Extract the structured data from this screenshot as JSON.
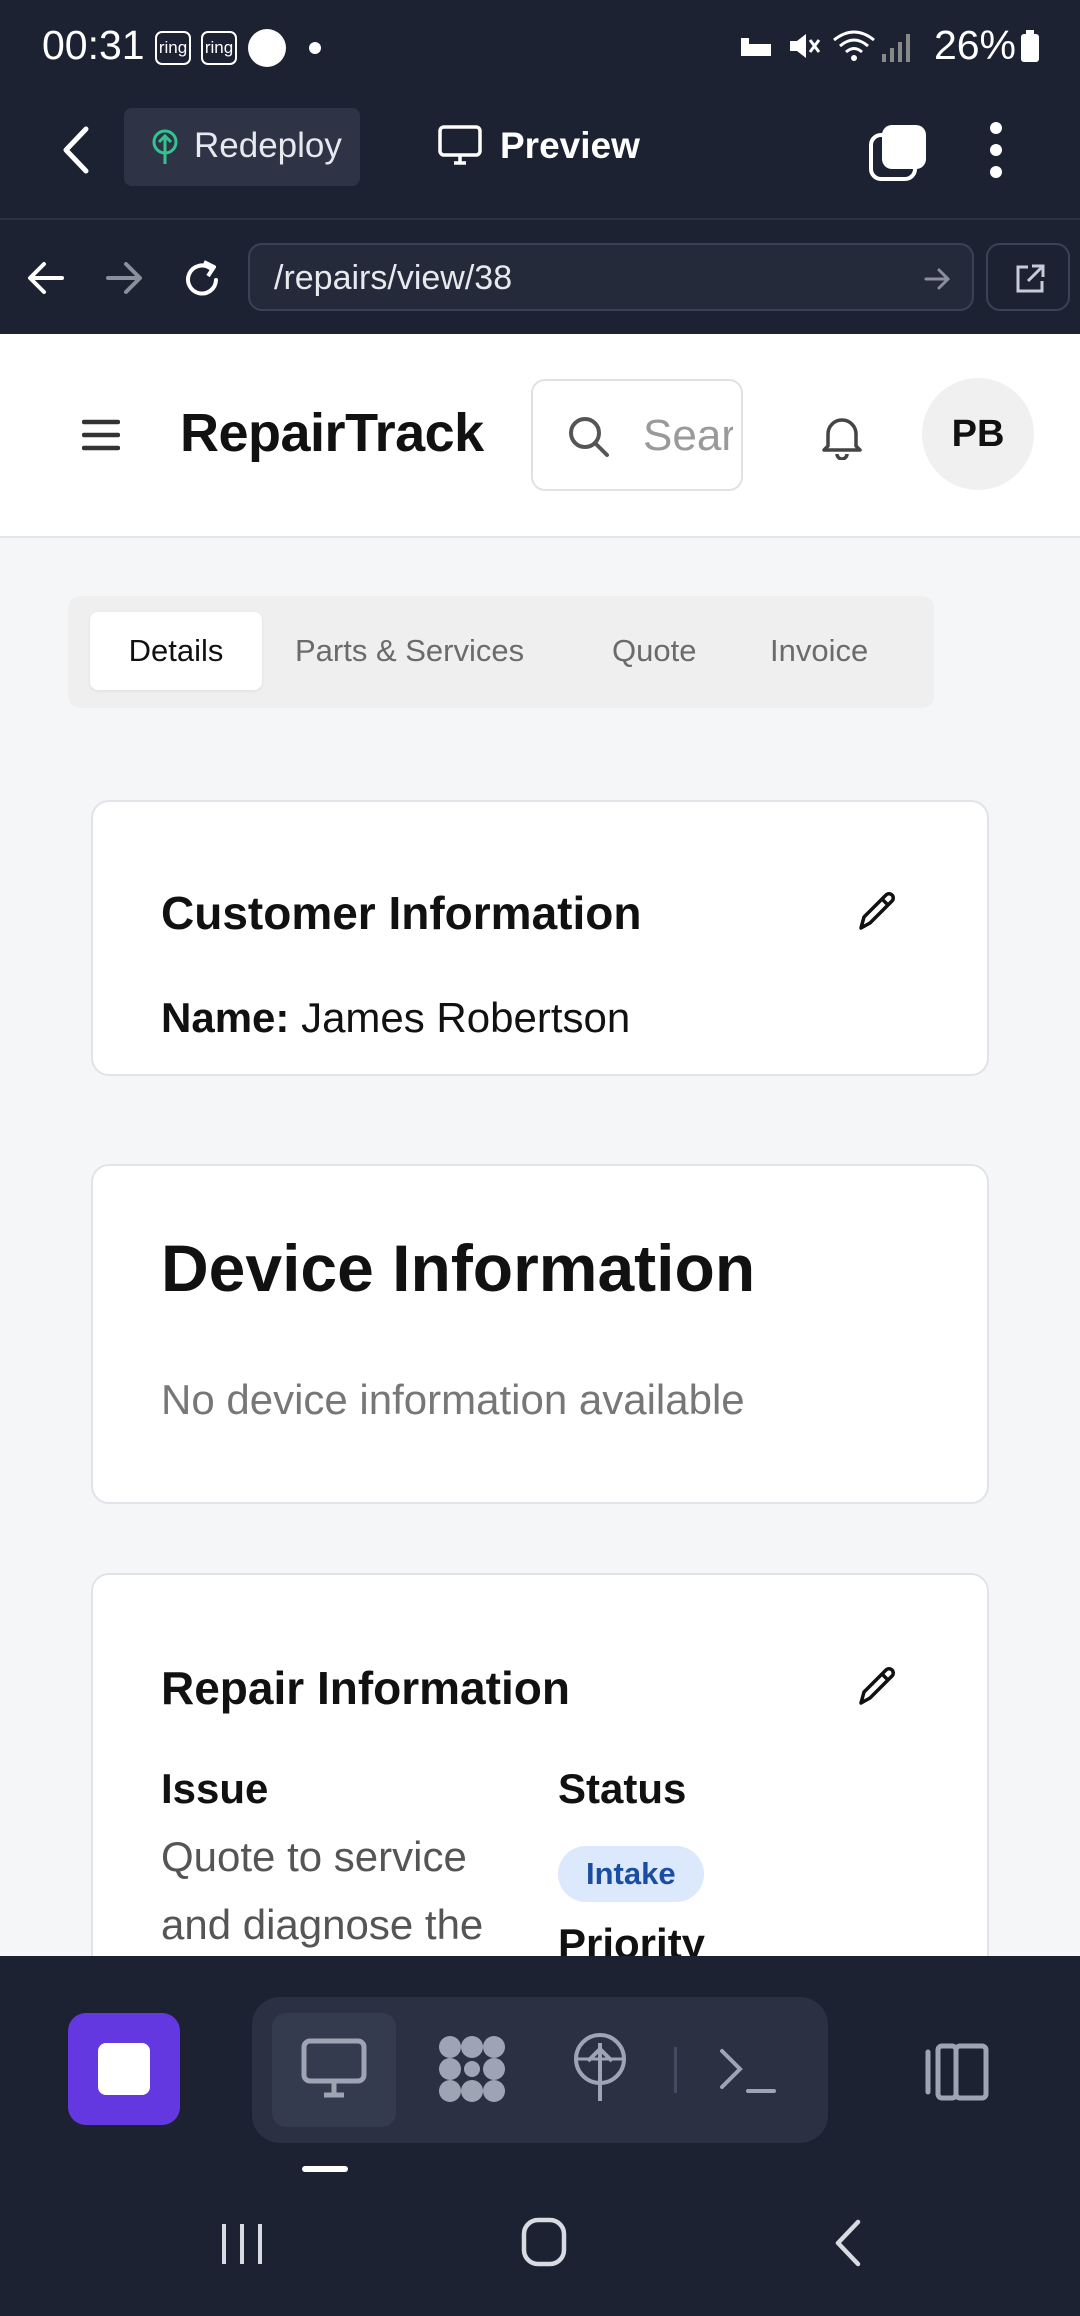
{
  "status_bar": {
    "time": "00:31",
    "badge_1": "ring",
    "badge_2": "ring",
    "battery": "26%"
  },
  "app_header": {
    "redeploy_label": "Redeploy",
    "preview_label": "Preview"
  },
  "url_bar": {
    "url": "/repairs/view/38"
  },
  "site": {
    "brand": "RepairTrack",
    "search_placeholder": "Search",
    "avatar_initials": "PB"
  },
  "tabs": [
    {
      "label": "Details",
      "active": true
    },
    {
      "label": "Parts & Services",
      "active": false
    },
    {
      "label": "Quote",
      "active": false
    },
    {
      "label": "Invoice",
      "active": false
    }
  ],
  "customer_card": {
    "title": "Customer Information",
    "name_label": "Name:",
    "name_value": "James Robertson"
  },
  "device_card": {
    "title": "Device Information",
    "empty_text": "No device information available"
  },
  "repair_card": {
    "title": "Repair Information",
    "issue_label": "Issue",
    "issue_text": "Quote to service and diagnose the",
    "status_label": "Status",
    "status_value": "Intake",
    "priority_label": "Priority"
  },
  "colors": {
    "chrome_bg": "#1d2232",
    "accent": "#6438e0",
    "badge_bg": "#dce8fb",
    "badge_text": "#1b4ea3"
  }
}
